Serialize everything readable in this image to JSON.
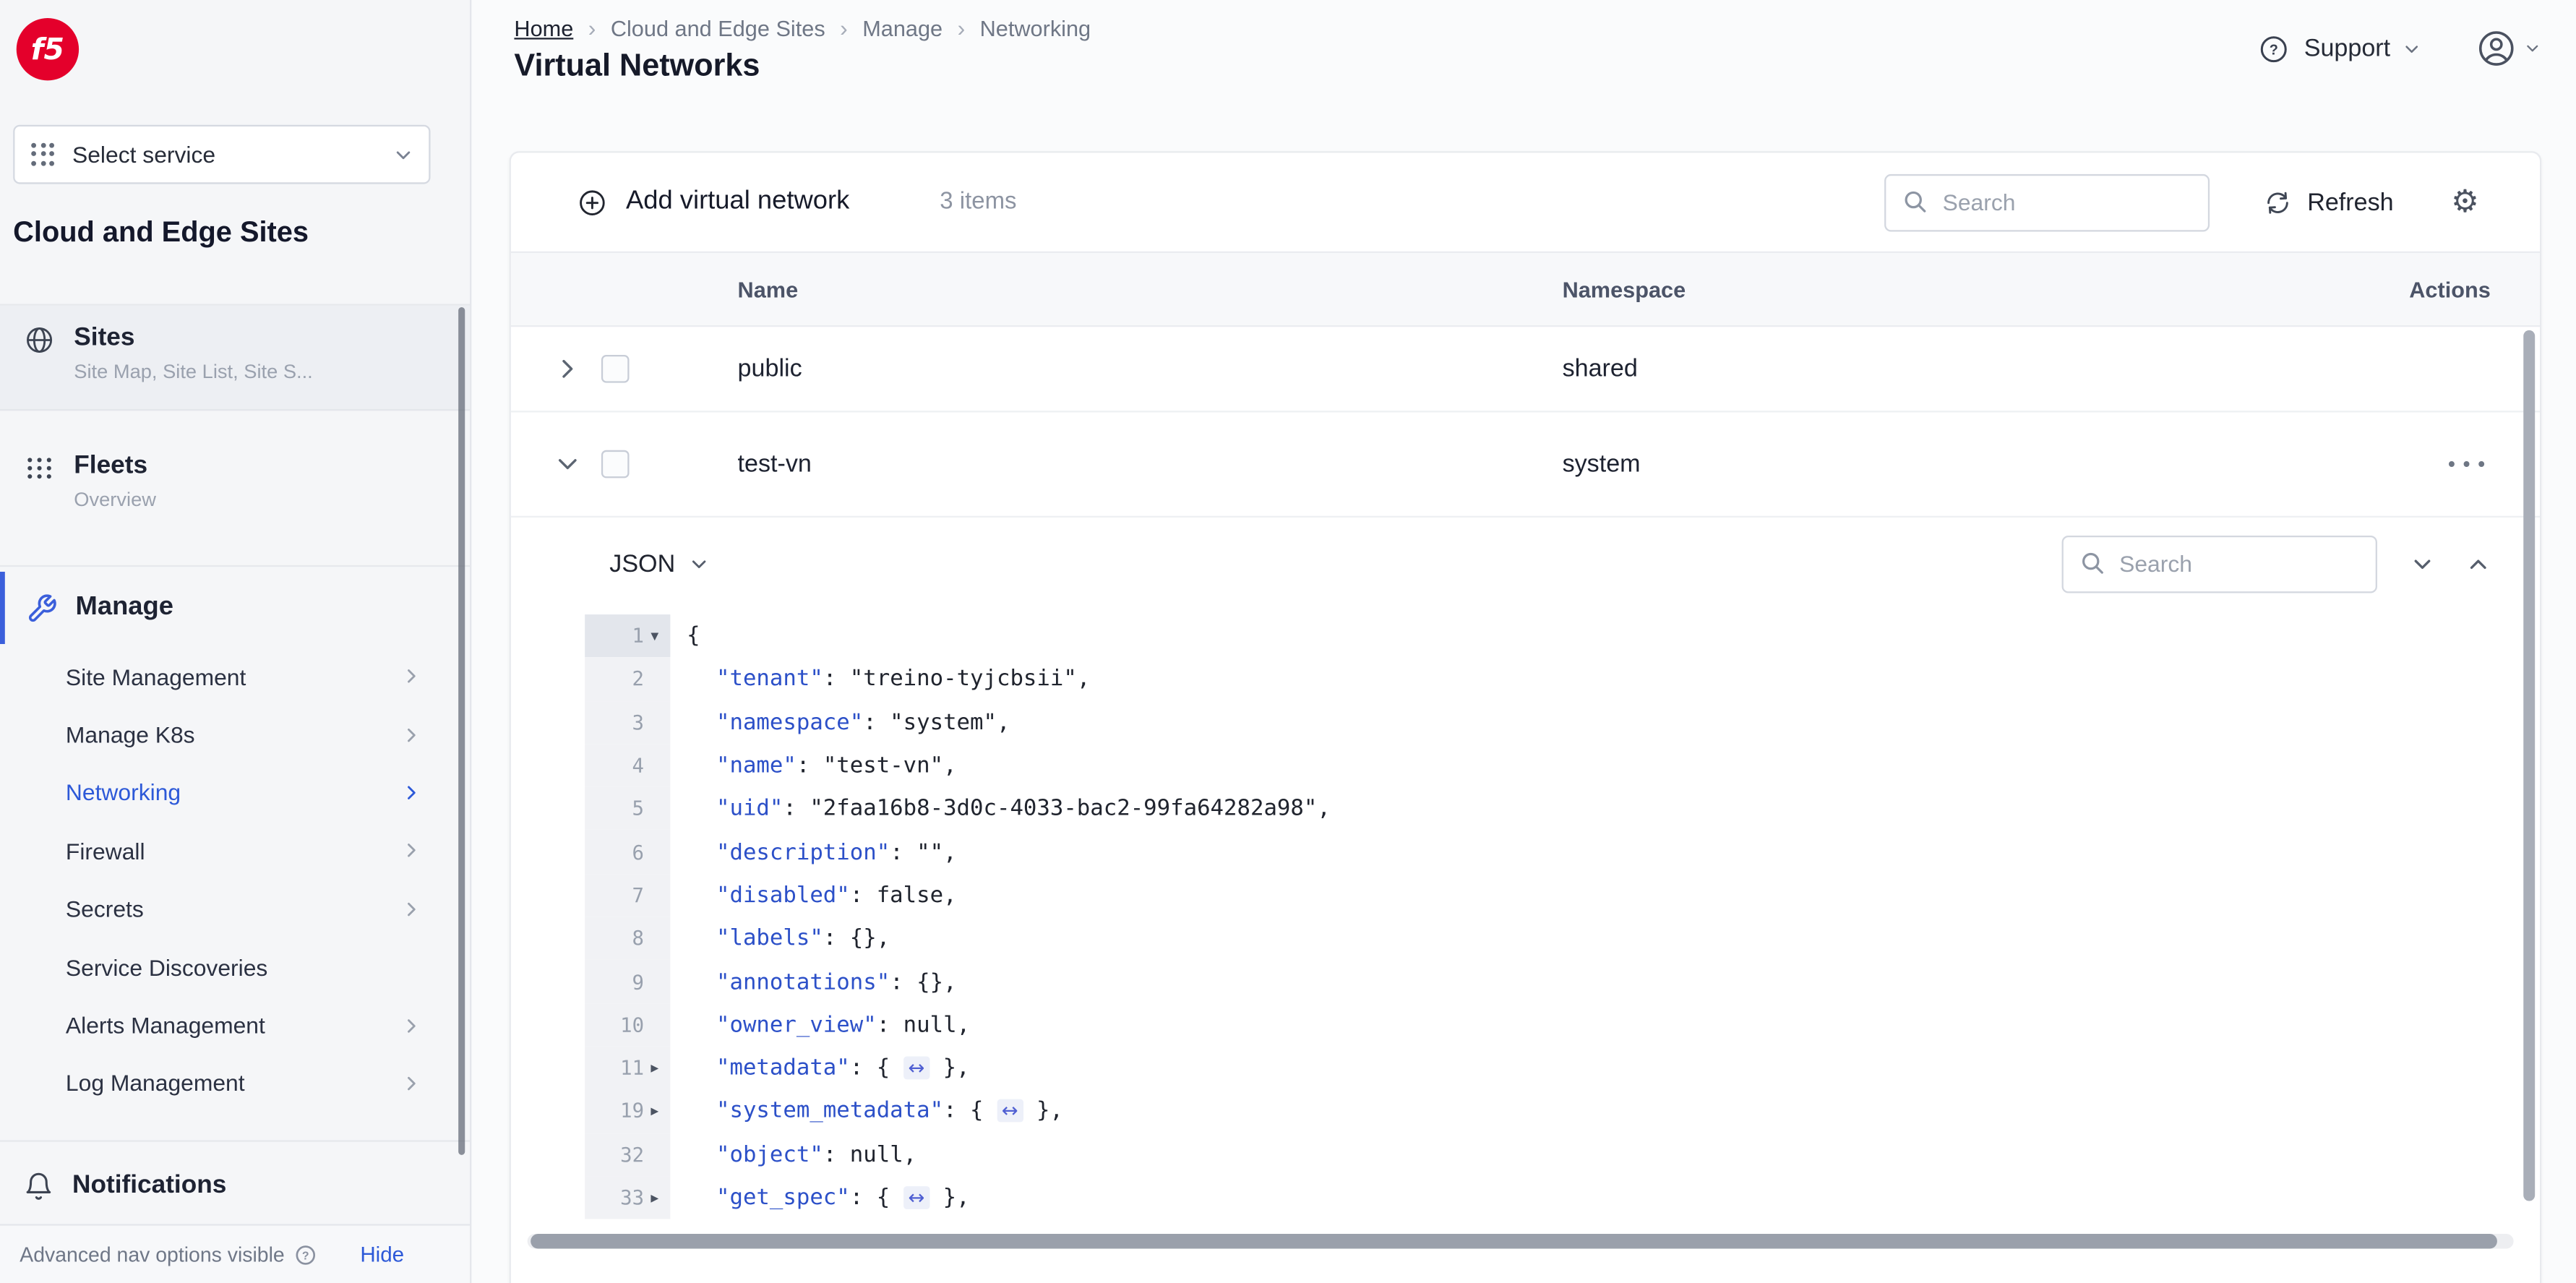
{
  "sidebar": {
    "logo": "f5",
    "service_selector_label": "Select service",
    "section_title": "Cloud and Edge Sites",
    "sites": {
      "title": "Sites",
      "subtitle": "Site Map, Site List, Site S..."
    },
    "fleets": {
      "title": "Fleets",
      "subtitle": "Overview"
    },
    "manage": {
      "title": "Manage"
    },
    "manage_items": [
      {
        "label": "Site Management",
        "chevron": true
      },
      {
        "label": "Manage K8s",
        "chevron": true
      },
      {
        "label": "Networking",
        "chevron": true,
        "active": true
      },
      {
        "label": "Firewall",
        "chevron": true
      },
      {
        "label": "Secrets",
        "chevron": true
      },
      {
        "label": "Service Discoveries",
        "chevron": false
      },
      {
        "label": "Alerts Management",
        "chevron": true
      },
      {
        "label": "Log Management",
        "chevron": true
      }
    ],
    "notifications_label": "Notifications",
    "footer_text": "Advanced nav options visible",
    "footer_hide": "Hide"
  },
  "header": {
    "breadcrumbs": [
      "Home",
      "Cloud and Edge Sites",
      "Manage",
      "Networking"
    ],
    "separator": "›",
    "title": "Virtual Networks",
    "support": "Support"
  },
  "toolbar": {
    "add_label": "Add virtual network",
    "count": "3 items",
    "search_placeholder": "Search",
    "refresh_label": "Refresh"
  },
  "table": {
    "columns": [
      "Name",
      "Namespace",
      "Actions"
    ],
    "rows": [
      {
        "name": "public",
        "namespace": "shared"
      },
      {
        "name": "test-vn",
        "namespace": "system"
      }
    ],
    "row_actions": "•••"
  },
  "panel": {
    "mode": "JSON",
    "search_placeholder": "Search",
    "lines": [
      {
        "n": "1",
        "c": "▾",
        "k": "",
        "p": "{",
        "f": "",
        "t": ""
      },
      {
        "n": "2",
        "c": "",
        "k": "\"tenant\"",
        "p": ": \"treino-tyjcbsii\",",
        "f": "",
        "t": ""
      },
      {
        "n": "3",
        "c": "",
        "k": "\"namespace\"",
        "p": ": \"system\",",
        "f": "",
        "t": ""
      },
      {
        "n": "4",
        "c": "",
        "k": "\"name\"",
        "p": ": \"test-vn\",",
        "f": "",
        "t": ""
      },
      {
        "n": "5",
        "c": "",
        "k": "\"uid\"",
        "p": ": \"2faa16b8-3d0c-4033-bac2-99fa64282a98\",",
        "f": "",
        "t": ""
      },
      {
        "n": "6",
        "c": "",
        "k": "\"description\"",
        "p": ": \"\",",
        "f": "",
        "t": ""
      },
      {
        "n": "7",
        "c": "",
        "k": "\"disabled\"",
        "p": ": false,",
        "f": "",
        "t": ""
      },
      {
        "n": "8",
        "c": "",
        "k": "\"labels\"",
        "p": ": {},",
        "f": "",
        "t": ""
      },
      {
        "n": "9",
        "c": "",
        "k": "\"annotations\"",
        "p": ": {},",
        "f": "",
        "t": ""
      },
      {
        "n": "10",
        "c": "",
        "k": "\"owner_view\"",
        "p": ": null,",
        "f": "",
        "t": ""
      },
      {
        "n": "11",
        "c": "▸",
        "k": "\"metadata\"",
        "p": ": { ",
        "f": "↔",
        "t": " },"
      },
      {
        "n": "19",
        "c": "▸",
        "k": "\"system_metadata\"",
        "p": ": { ",
        "f": "↔",
        "t": " },"
      },
      {
        "n": "32",
        "c": "",
        "k": "\"object\"",
        "p": ": null,",
        "f": "",
        "t": ""
      },
      {
        "n": "33",
        "c": "▸",
        "k": "\"get_spec\"",
        "p": ": { ",
        "f": "↔",
        "t": " },"
      }
    ]
  },
  "icons": {
    "gear": "⚙"
  },
  "colors": {
    "accent": "#3b5fdb",
    "logo_red": "#e4002b"
  }
}
